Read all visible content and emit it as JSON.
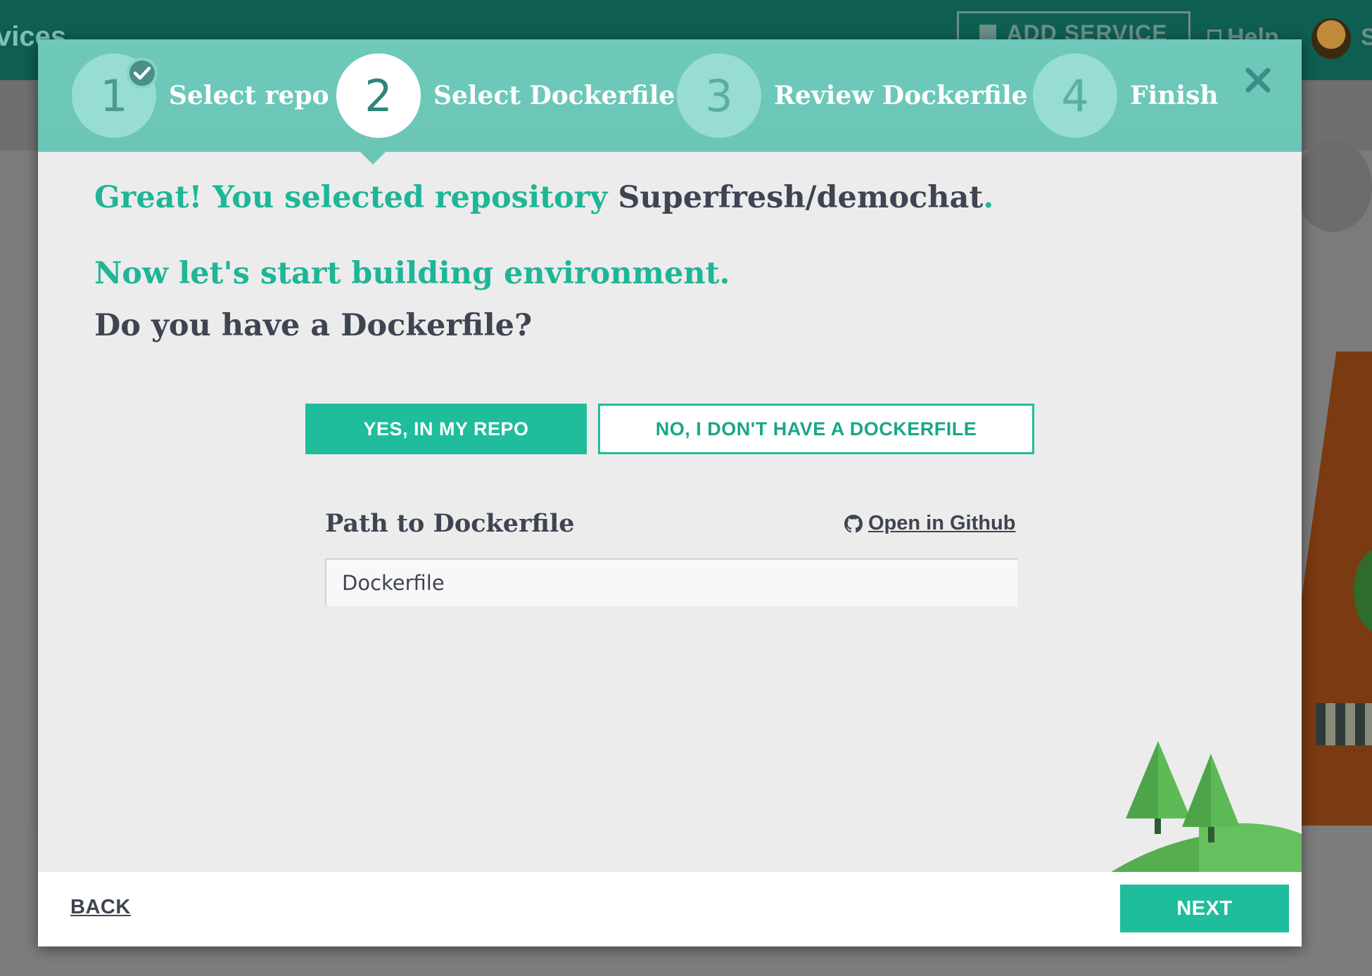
{
  "background": {
    "left_title": "vices",
    "add_service_label": "ADD SERVICE",
    "help_label": "Help",
    "user_initial": "S"
  },
  "wizard": {
    "steps": [
      {
        "number": "1",
        "label": "Select repo",
        "state": "done"
      },
      {
        "number": "2",
        "label": "Select Dockerfile",
        "state": "active"
      },
      {
        "number": "3",
        "label": "Review Dockerfile",
        "state": "pending"
      },
      {
        "number": "4",
        "label": "Finish",
        "state": "pending"
      }
    ],
    "close_icon": "close-icon"
  },
  "content": {
    "selected_prefix": "Great! You selected repository",
    "selected_repo": "Superfresh/demochat",
    "selected_suffix": ".",
    "build_heading": "Now let's start building environment.",
    "question": "Do you have a Dockerfile?",
    "yes_button": "YES, IN MY REPO",
    "no_button": "NO, I DON'T HAVE A DOCKERFILE",
    "path_label": "Path to Dockerfile",
    "github_link": "Open in Github",
    "path_value": "Dockerfile"
  },
  "footer": {
    "back_label": "BACK",
    "next_label": "NEXT"
  },
  "colors": {
    "accent": "#1fbd9b",
    "header": "#6bc6b7",
    "text_dark": "#3f4452",
    "topbar": "#0e5e52"
  }
}
